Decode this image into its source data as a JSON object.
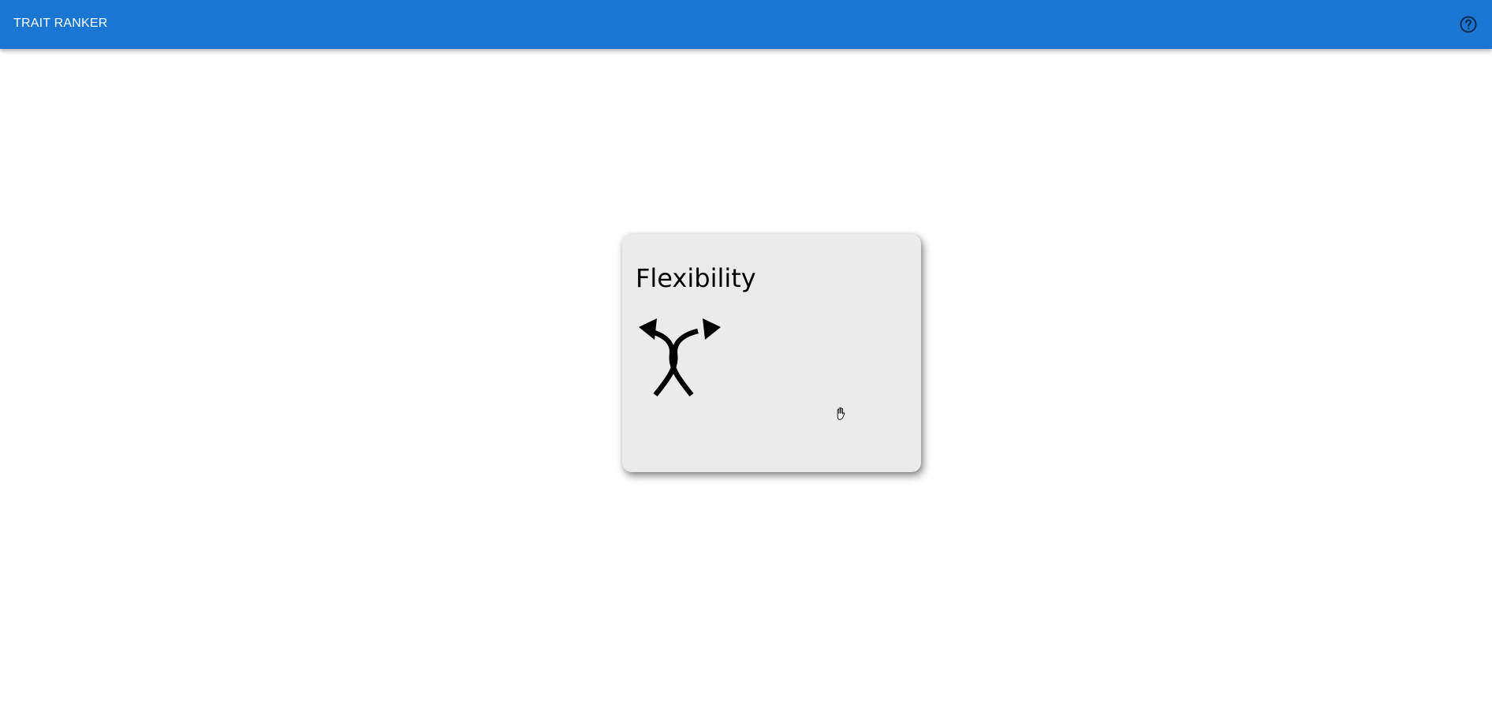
{
  "app_bar": {
    "title": "TRAIT RANKER",
    "color": "#1976d2",
    "help_icon": "help-circle-icon"
  },
  "card": {
    "title": "Flexibility",
    "icon": "diverging-arrows-icon",
    "background": "#ebebeb"
  },
  "cursor": {
    "icon": "grab-hand-icon"
  }
}
